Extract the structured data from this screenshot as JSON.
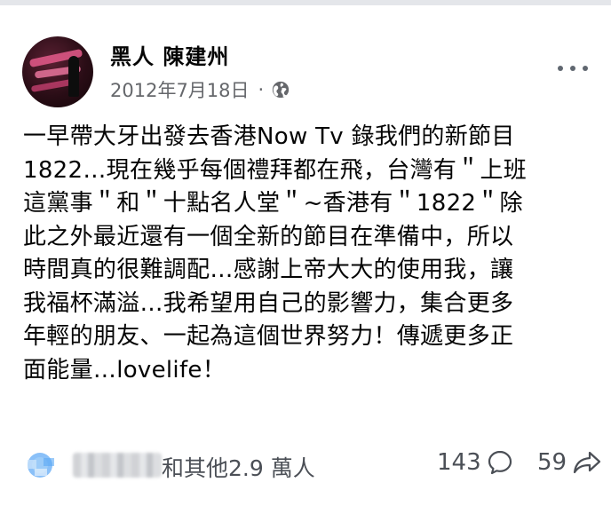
{
  "post": {
    "author": "黑人 陳建州",
    "date": "2012年7月18日",
    "separator": "·",
    "audience_icon": "globe-icon",
    "text": "一早帶大牙出發去香港Now Tv 錄我們的新節目\n1822…現在幾乎每個禮拜都在飛，台灣有＂上班\n這黨事＂和＂十點名人堂＂~香港有＂1822＂除\n此之外最近還有一個全新的節目在準備中，所以\n時間真的很難調配…感謝上帝大大的使用我，讓\n我福杯滿溢…我希望用自己的影響力，集合更多\n年輕的朋友、一起為這個世界努力！傳遞更多正\n面能量…lovelife！"
  },
  "engagement": {
    "likes_text": "和其他2.9 萬人",
    "comments_count": "143",
    "shares_count": "59",
    "reaction_icon": "reactions-icon",
    "comment_icon": "comment-icon",
    "share_icon": "share-icon"
  },
  "colors": {
    "text": "#050505",
    "secondary": "#65676b",
    "icon": "#606770"
  }
}
